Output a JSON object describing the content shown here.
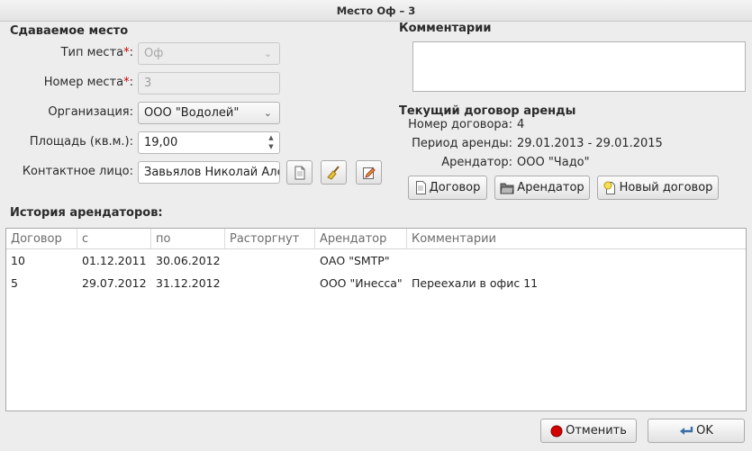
{
  "window": {
    "title": "Место Оф – 3"
  },
  "place": {
    "section_title": "Сдаваемое место",
    "type_label": "Тип места",
    "type_value": "Оф",
    "number_label": "Номер места",
    "number_value": "3",
    "required_mark": "*",
    "org_label": "Организация:",
    "org_value": "ООО \"Водолей\"",
    "area_label": "Площадь (кв.м.):",
    "area_value": "19,00",
    "contact_label": "Контактное лицо:",
    "contact_value": "Завьялов Николай Але"
  },
  "comments": {
    "title": "Комментарии",
    "value": ""
  },
  "contract": {
    "title": "Текущий договор аренды",
    "number_label": "Номер договора:",
    "number_value": "4",
    "period_label": "Период аренды:",
    "period_value": "29.01.2013 - 29.01.2015",
    "tenant_label": "Арендатор:",
    "tenant_value": "ООО \"Чадо\"",
    "btn_contract": "Договор",
    "btn_tenant": "Арендатор",
    "btn_new": "Новый договор"
  },
  "history": {
    "title": "История арендаторов:",
    "columns": [
      "Договор",
      "с",
      "по",
      "Расторгнут",
      "Арендатор",
      "Комментарии"
    ],
    "rows": [
      [
        "10",
        "01.12.2011",
        "30.06.2012",
        "",
        "ОАО \"SMTP\"",
        ""
      ],
      [
        "5",
        "29.07.2012",
        "31.12.2012",
        "",
        "ООО \"Инесса\"",
        "Переехали в офис 11"
      ]
    ]
  },
  "footer": {
    "cancel": "Отменить",
    "ok": "OK"
  },
  "colors": {
    "required": "#d00000",
    "cancel_icon": "#d40000"
  }
}
